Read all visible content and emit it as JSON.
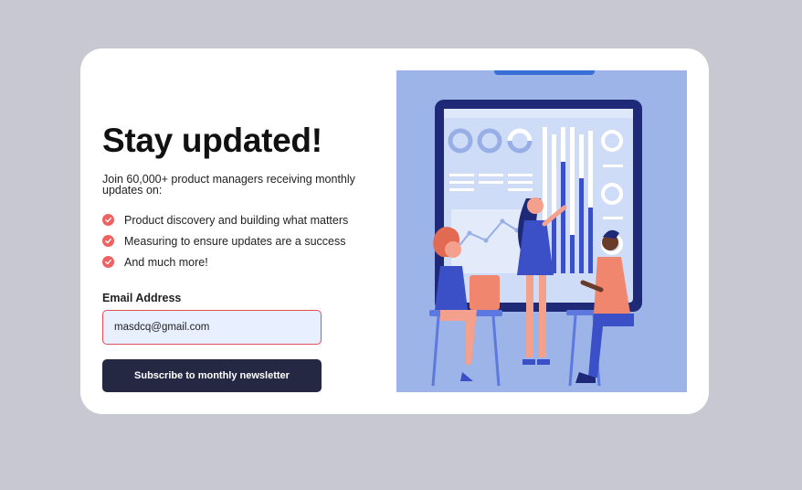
{
  "newsletter": {
    "title": "Stay updated!",
    "intro": "Join 60,000+ product managers receiving monthly updates on:",
    "benefits": [
      "Product discovery and building what matters",
      "Measuring to ensure updates are a success",
      "And much more!"
    ],
    "email_label": "Email Address",
    "email_value": "masdcq@gmail.com",
    "subscribe_label": "Subscribe to monthly newsletter"
  },
  "colors": {
    "page_background": "#c8c8d3",
    "card_background": "#ffffff",
    "accent_red": "#ef6262",
    "button_dark": "#242842",
    "input_background": "#e8efff",
    "illustration_background": "#9db4e8"
  },
  "icons": {
    "benefit": "check-circle-icon"
  }
}
